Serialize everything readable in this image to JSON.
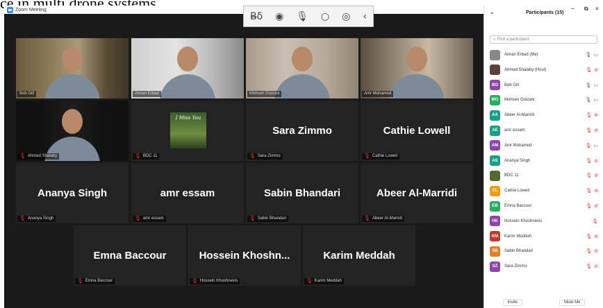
{
  "top_text": "ce in multi drone systems.",
  "window": {
    "title": "Zoom Meeting"
  },
  "colors": {
    "active_speaker": "#c9d93a",
    "muted": "#e53935",
    "background": "#1a1a1a"
  },
  "toolbar_icons": [
    "recording-icon",
    "record-dot-icon",
    "microphone-icon",
    "circle-icon",
    "broadcast-icon",
    "chevron-left-icon"
  ],
  "video_tiles": [
    {
      "name": "Bob Gill",
      "muted": false,
      "type": "video",
      "active": true
    },
    {
      "name": "Aiman Erbad",
      "muted": false,
      "type": "video"
    },
    {
      "name": "Mohsen Guizani",
      "muted": false,
      "type": "video"
    },
    {
      "name": "Amr Mohamed",
      "muted": false,
      "type": "video"
    },
    {
      "name": "Ahmed Shalaby",
      "muted": true,
      "type": "video"
    },
    {
      "name": "BDC 11",
      "muted": true,
      "type": "image",
      "image_text": "I Miss You"
    },
    {
      "name": "Sara Zimmo",
      "muted": true,
      "type": "name"
    },
    {
      "name": "Cathie Lowell",
      "muted": true,
      "type": "name"
    },
    {
      "name": "Ananya Singh",
      "muted": true,
      "type": "name"
    },
    {
      "name": "amr essam",
      "muted": true,
      "type": "name"
    },
    {
      "name": "Sabin Bhandari",
      "muted": true,
      "type": "name"
    },
    {
      "name": "Abeer Al-Marridi",
      "muted": true,
      "type": "name"
    },
    {
      "name": "Emna Baccour",
      "display": "Emna Baccour",
      "muted": true,
      "type": "name"
    },
    {
      "name": "Hossein Khoshnevis",
      "display": "Hossein Khoshn...",
      "muted": true,
      "type": "name"
    },
    {
      "name": "Karim Meddah",
      "display": "Karim Meddah",
      "muted": true,
      "type": "name"
    }
  ],
  "participants_panel": {
    "title": "Participants (15)",
    "search_placeholder": "Find a participant",
    "participants": [
      {
        "name": "Aiman Erbad (Me)",
        "initials": "",
        "color": "#888888",
        "muted": false,
        "video": true,
        "photo": true
      },
      {
        "name": "Ahmed Shalaby (Host)",
        "initials": "",
        "color": "#5d4037",
        "muted": true,
        "video": false,
        "photo": true
      },
      {
        "name": "Bob Gill",
        "initials": "BG",
        "color": "#8e44ad",
        "muted": false,
        "video": true
      },
      {
        "name": "Mohsen Guizani",
        "initials": "MG",
        "color": "#27ae60",
        "muted": false,
        "video": true
      },
      {
        "name": "Abeer Al-Marridi",
        "initials": "AA",
        "color": "#16a085",
        "muted": true,
        "video": false
      },
      {
        "name": "amr essam",
        "initials": "AE",
        "color": "#16a085",
        "muted": true,
        "video": false
      },
      {
        "name": "Amr Mohamed",
        "initials": "AM",
        "color": "#8e44ad",
        "muted": true,
        "video": true
      },
      {
        "name": "Ananya Singh",
        "initials": "AS",
        "color": "#16a085",
        "muted": true,
        "video": false
      },
      {
        "name": "BDC 11",
        "initials": "",
        "color": "#556b2f",
        "muted": true,
        "video": false,
        "photo": true
      },
      {
        "name": "Cathie Lowell",
        "initials": "CL",
        "color": "#f39c12",
        "muted": true,
        "video": false
      },
      {
        "name": "Emna Baccour",
        "initials": "EB",
        "color": "#27ae60",
        "muted": true,
        "video": false
      },
      {
        "name": "Hossein Khoshnevis",
        "initials": "HK",
        "color": "#8e44ad",
        "muted": true,
        "video": null
      },
      {
        "name": "Karim Meddah",
        "initials": "KM",
        "color": "#c0392b",
        "muted": true,
        "video": false
      },
      {
        "name": "Sabin Bhandari",
        "initials": "SB",
        "color": "#e67e22",
        "muted": true,
        "video": false
      },
      {
        "name": "Sara Zimmo",
        "initials": "SZ",
        "color": "#8e44ad",
        "muted": true,
        "video": false
      }
    ],
    "footer": {
      "invite_label": "Invite",
      "mute_me_label": "Mute Me"
    }
  }
}
